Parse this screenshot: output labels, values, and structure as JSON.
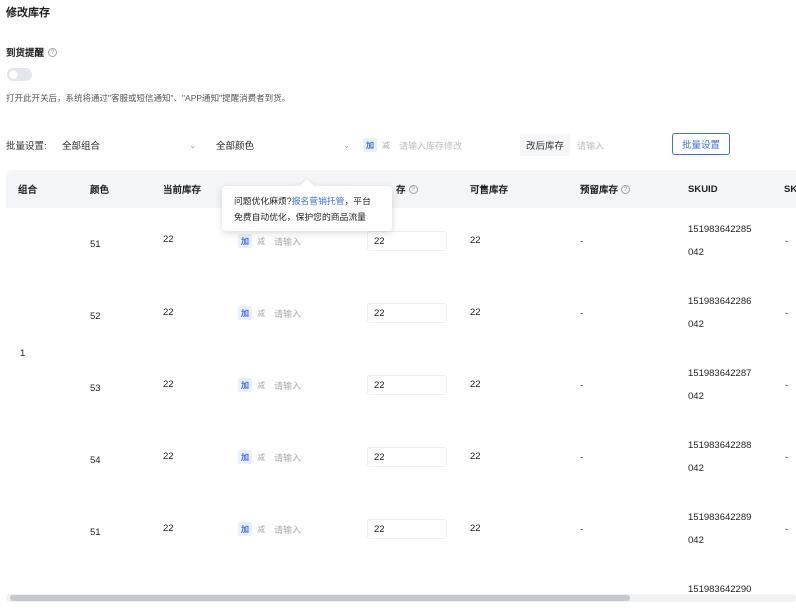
{
  "page_title": "修改库存",
  "arrival": {
    "label": "到货提醒",
    "hint": "打开此开关后，系统将通过\"客服或短信通知\"、\"APP通知\"提醒消费者到货。"
  },
  "batch": {
    "label": "批量设置:",
    "combo_value": "全部组合",
    "color_value": "全部颜色",
    "add": "加",
    "sub": "减",
    "stock_placeholder": "请输入库存修改",
    "after_label": "改后库存",
    "after_placeholder": "请输入",
    "button": "批量设置"
  },
  "table": {
    "headers": {
      "group": "组合",
      "color": "颜色",
      "current": "当前库存",
      "new_stock": "存",
      "sellable": "可售库存",
      "reserved": "预留库存",
      "skuid": "SKUID",
      "sk": "SK"
    },
    "group_value": "1",
    "add": "加",
    "sub": "减",
    "input_placeholder": "请输入",
    "rows": [
      {
        "color": "51",
        "current": "22",
        "new_stock": "22",
        "sellable": "22",
        "reserved": "-",
        "sku_a": "151983642285",
        "sku_b": "042",
        "sk": "-"
      },
      {
        "color": "52",
        "current": "22",
        "new_stock": "22",
        "sellable": "22",
        "reserved": "-",
        "sku_a": "151983642286",
        "sku_b": "042",
        "sk": "-"
      },
      {
        "color": "53",
        "current": "22",
        "new_stock": "22",
        "sellable": "22",
        "reserved": "-",
        "sku_a": "151983642287",
        "sku_b": "042",
        "sk": "-"
      },
      {
        "color": "54",
        "current": "22",
        "new_stock": "22",
        "sellable": "22",
        "reserved": "-",
        "sku_a": "151983642288",
        "sku_b": "042",
        "sk": "-"
      },
      {
        "color": "51",
        "current": "22",
        "new_stock": "22",
        "sellable": "22",
        "reserved": "-",
        "sku_a": "151983642289",
        "sku_b": "042",
        "sk": "-"
      }
    ],
    "partial_sku": "151983642290"
  },
  "tooltip": {
    "prefix": "问题优化麻烦?",
    "link": "报名营销托管",
    "suffix": "，平台",
    "line2": "免费自动优化，保护您的商品流量"
  },
  "colors": {
    "accent": "#3a6df0",
    "header_bg": "#f4f5f7"
  }
}
